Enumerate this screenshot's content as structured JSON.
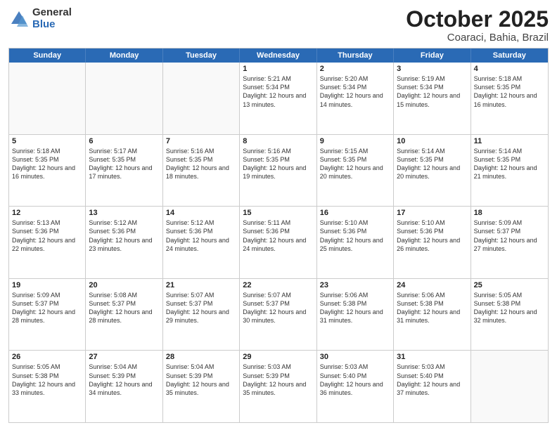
{
  "logo": {
    "general": "General",
    "blue": "Blue"
  },
  "title": {
    "month": "October 2025",
    "location": "Coaraci, Bahia, Brazil"
  },
  "headers": [
    "Sunday",
    "Monday",
    "Tuesday",
    "Wednesday",
    "Thursday",
    "Friday",
    "Saturday"
  ],
  "weeks": [
    [
      {
        "day": "",
        "sunrise": "",
        "sunset": "",
        "daylight": "",
        "empty": true
      },
      {
        "day": "",
        "sunrise": "",
        "sunset": "",
        "daylight": "",
        "empty": true
      },
      {
        "day": "",
        "sunrise": "",
        "sunset": "",
        "daylight": "",
        "empty": true
      },
      {
        "day": "1",
        "sunrise": "Sunrise: 5:21 AM",
        "sunset": "Sunset: 5:34 PM",
        "daylight": "Daylight: 12 hours and 13 minutes."
      },
      {
        "day": "2",
        "sunrise": "Sunrise: 5:20 AM",
        "sunset": "Sunset: 5:34 PM",
        "daylight": "Daylight: 12 hours and 14 minutes."
      },
      {
        "day": "3",
        "sunrise": "Sunrise: 5:19 AM",
        "sunset": "Sunset: 5:34 PM",
        "daylight": "Daylight: 12 hours and 15 minutes."
      },
      {
        "day": "4",
        "sunrise": "Sunrise: 5:18 AM",
        "sunset": "Sunset: 5:35 PM",
        "daylight": "Daylight: 12 hours and 16 minutes."
      }
    ],
    [
      {
        "day": "5",
        "sunrise": "Sunrise: 5:18 AM",
        "sunset": "Sunset: 5:35 PM",
        "daylight": "Daylight: 12 hours and 16 minutes."
      },
      {
        "day": "6",
        "sunrise": "Sunrise: 5:17 AM",
        "sunset": "Sunset: 5:35 PM",
        "daylight": "Daylight: 12 hours and 17 minutes."
      },
      {
        "day": "7",
        "sunrise": "Sunrise: 5:16 AM",
        "sunset": "Sunset: 5:35 PM",
        "daylight": "Daylight: 12 hours and 18 minutes."
      },
      {
        "day": "8",
        "sunrise": "Sunrise: 5:16 AM",
        "sunset": "Sunset: 5:35 PM",
        "daylight": "Daylight: 12 hours and 19 minutes."
      },
      {
        "day": "9",
        "sunrise": "Sunrise: 5:15 AM",
        "sunset": "Sunset: 5:35 PM",
        "daylight": "Daylight: 12 hours and 20 minutes."
      },
      {
        "day": "10",
        "sunrise": "Sunrise: 5:14 AM",
        "sunset": "Sunset: 5:35 PM",
        "daylight": "Daylight: 12 hours and 20 minutes."
      },
      {
        "day": "11",
        "sunrise": "Sunrise: 5:14 AM",
        "sunset": "Sunset: 5:35 PM",
        "daylight": "Daylight: 12 hours and 21 minutes."
      }
    ],
    [
      {
        "day": "12",
        "sunrise": "Sunrise: 5:13 AM",
        "sunset": "Sunset: 5:36 PM",
        "daylight": "Daylight: 12 hours and 22 minutes."
      },
      {
        "day": "13",
        "sunrise": "Sunrise: 5:12 AM",
        "sunset": "Sunset: 5:36 PM",
        "daylight": "Daylight: 12 hours and 23 minutes."
      },
      {
        "day": "14",
        "sunrise": "Sunrise: 5:12 AM",
        "sunset": "Sunset: 5:36 PM",
        "daylight": "Daylight: 12 hours and 24 minutes."
      },
      {
        "day": "15",
        "sunrise": "Sunrise: 5:11 AM",
        "sunset": "Sunset: 5:36 PM",
        "daylight": "Daylight: 12 hours and 24 minutes."
      },
      {
        "day": "16",
        "sunrise": "Sunrise: 5:10 AM",
        "sunset": "Sunset: 5:36 PM",
        "daylight": "Daylight: 12 hours and 25 minutes."
      },
      {
        "day": "17",
        "sunrise": "Sunrise: 5:10 AM",
        "sunset": "Sunset: 5:36 PM",
        "daylight": "Daylight: 12 hours and 26 minutes."
      },
      {
        "day": "18",
        "sunrise": "Sunrise: 5:09 AM",
        "sunset": "Sunset: 5:37 PM",
        "daylight": "Daylight: 12 hours and 27 minutes."
      }
    ],
    [
      {
        "day": "19",
        "sunrise": "Sunrise: 5:09 AM",
        "sunset": "Sunset: 5:37 PM",
        "daylight": "Daylight: 12 hours and 28 minutes."
      },
      {
        "day": "20",
        "sunrise": "Sunrise: 5:08 AM",
        "sunset": "Sunset: 5:37 PM",
        "daylight": "Daylight: 12 hours and 28 minutes."
      },
      {
        "day": "21",
        "sunrise": "Sunrise: 5:07 AM",
        "sunset": "Sunset: 5:37 PM",
        "daylight": "Daylight: 12 hours and 29 minutes."
      },
      {
        "day": "22",
        "sunrise": "Sunrise: 5:07 AM",
        "sunset": "Sunset: 5:37 PM",
        "daylight": "Daylight: 12 hours and 30 minutes."
      },
      {
        "day": "23",
        "sunrise": "Sunrise: 5:06 AM",
        "sunset": "Sunset: 5:38 PM",
        "daylight": "Daylight: 12 hours and 31 minutes."
      },
      {
        "day": "24",
        "sunrise": "Sunrise: 5:06 AM",
        "sunset": "Sunset: 5:38 PM",
        "daylight": "Daylight: 12 hours and 31 minutes."
      },
      {
        "day": "25",
        "sunrise": "Sunrise: 5:05 AM",
        "sunset": "Sunset: 5:38 PM",
        "daylight": "Daylight: 12 hours and 32 minutes."
      }
    ],
    [
      {
        "day": "26",
        "sunrise": "Sunrise: 5:05 AM",
        "sunset": "Sunset: 5:38 PM",
        "daylight": "Daylight: 12 hours and 33 minutes."
      },
      {
        "day": "27",
        "sunrise": "Sunrise: 5:04 AM",
        "sunset": "Sunset: 5:39 PM",
        "daylight": "Daylight: 12 hours and 34 minutes."
      },
      {
        "day": "28",
        "sunrise": "Sunrise: 5:04 AM",
        "sunset": "Sunset: 5:39 PM",
        "daylight": "Daylight: 12 hours and 35 minutes."
      },
      {
        "day": "29",
        "sunrise": "Sunrise: 5:03 AM",
        "sunset": "Sunset: 5:39 PM",
        "daylight": "Daylight: 12 hours and 35 minutes."
      },
      {
        "day": "30",
        "sunrise": "Sunrise: 5:03 AM",
        "sunset": "Sunset: 5:40 PM",
        "daylight": "Daylight: 12 hours and 36 minutes."
      },
      {
        "day": "31",
        "sunrise": "Sunrise: 5:03 AM",
        "sunset": "Sunset: 5:40 PM",
        "daylight": "Daylight: 12 hours and 37 minutes."
      },
      {
        "day": "",
        "sunrise": "",
        "sunset": "",
        "daylight": "",
        "empty": true
      }
    ]
  ]
}
